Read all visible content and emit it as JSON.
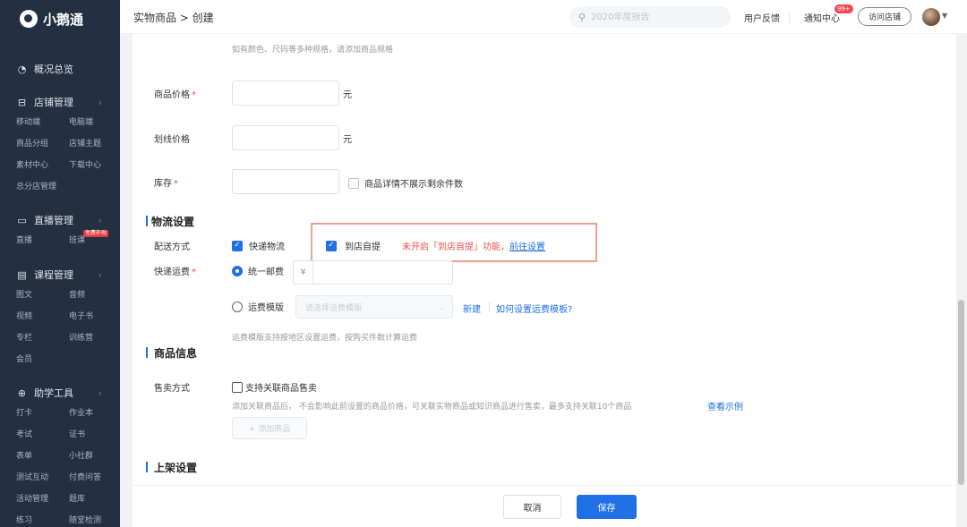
{
  "brand": {
    "name": "小鹅通"
  },
  "sidebar": {
    "overview": "概况总览",
    "store": {
      "title": "店铺管理",
      "items": [
        "移动端",
        "电脑端",
        "商品分组",
        "店铺主题",
        "素材中心",
        "下载中心",
        "总分店管理"
      ]
    },
    "live": {
      "title": "直播管理",
      "items": [
        "直播",
        "班课"
      ],
      "badge": "免费补贴"
    },
    "course": {
      "title": "课程管理",
      "items": [
        "图文",
        "音频",
        "视频",
        "电子书",
        "专栏",
        "训练营",
        "会员"
      ]
    },
    "tools": {
      "title": "助学工具",
      "items": [
        "打卡",
        "作业本",
        "考试",
        "证书",
        "表单",
        "小社群",
        "测试互动",
        "付费问答",
        "活动管理",
        "题库",
        "练习",
        "随堂检测"
      ]
    },
    "chevron": "›"
  },
  "topbar": {
    "breadcrumb": "实物商品 > 创建",
    "search_placeholder": "2020年度报告",
    "feedback": "用户反馈",
    "notify": "通知中心",
    "notify_badge": "99+",
    "visit_store": "访问店铺"
  },
  "form": {
    "spec_hint": "如有颜色、尺码等多种规格，请添加商品规格",
    "price": {
      "label": "商品价格",
      "required": "*",
      "value": "",
      "unit": "元"
    },
    "strike_price": {
      "label": "划线价格",
      "value": "",
      "unit": "元"
    },
    "stock": {
      "label": "库存",
      "required": "*",
      "value": "",
      "hide_remaining_label": "商品详情不展示剩余件数",
      "hide_remaining_checked": false
    },
    "logistics": {
      "title": "物流设置",
      "delivery_label": "配送方式",
      "express": {
        "label": "快递物流",
        "checked": true
      },
      "pickup": {
        "label": "到店自提",
        "checked": true
      },
      "pickup_warning": "未开启「到店自提」功能，",
      "pickup_link": "前往设置",
      "freight_label": "快递运费",
      "freight_required": "*",
      "flat_rate": {
        "label": "统一邮费",
        "selected": true,
        "currency": "¥",
        "value": ""
      },
      "template": {
        "label": "运费模版",
        "selected": false,
        "placeholder": "请选择运费模版",
        "new_link": "新建",
        "help_link": "如何设置运费模板?"
      },
      "template_hint": "运费模版支持按地区设置运费，按购买件数计算运费"
    },
    "product_info": {
      "title": "商品信息",
      "sale_mode_label": "售卖方式",
      "bundle_label": "支持关联商品售卖",
      "bundle_checked": false,
      "bundle_hint": "添加关联商品后， 不会影响此前设置的商品价格，可关联实物商品或知识商品进行售卖，最多支持关联10个商品",
      "example_link": "查看示例",
      "add_button": "+ 添加商品"
    },
    "listing": {
      "title": "上架设置"
    }
  },
  "footer": {
    "cancel": "取消",
    "save": "保存"
  },
  "colors": {
    "primary": "#1f6fe5",
    "sidebar_bg": "#232f42",
    "warning": "#f05050",
    "highlight_border": "#f0a090"
  }
}
